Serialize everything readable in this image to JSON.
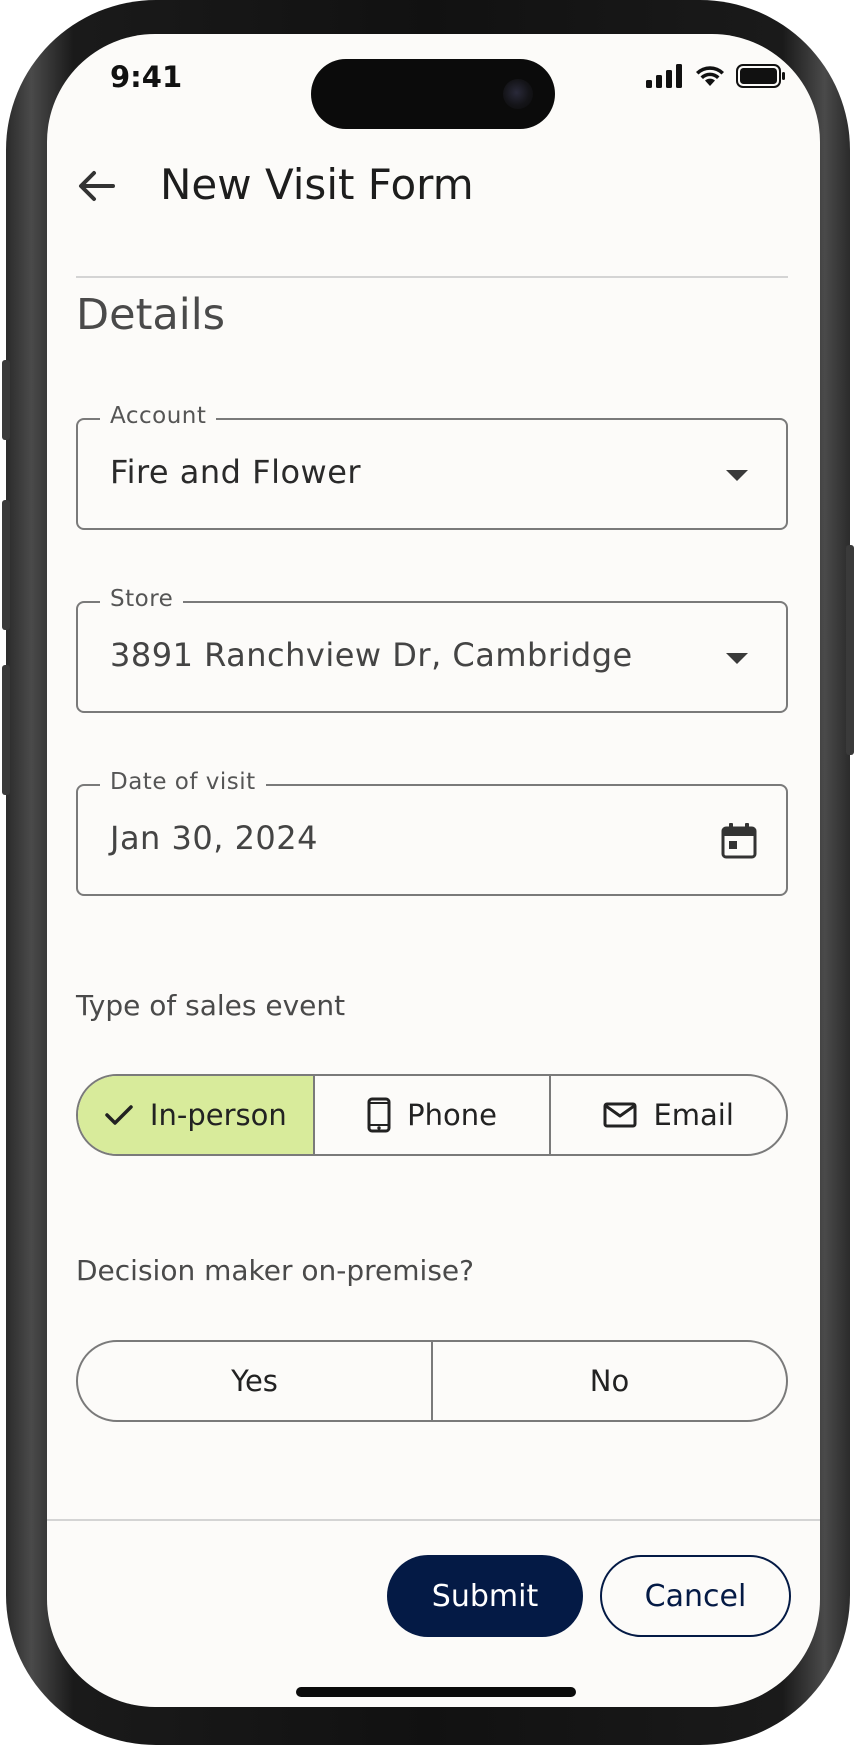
{
  "status_bar": {
    "time": "9:41"
  },
  "header": {
    "title": "New Visit Form"
  },
  "section": {
    "title": "Details"
  },
  "fields": {
    "account": {
      "label": "Account",
      "value": "Fire and Flower"
    },
    "store": {
      "label": "Store",
      "value": "3891 Ranchview Dr, Cambridge"
    },
    "date": {
      "label": "Date of visit",
      "value": "Jan 30, 2024"
    }
  },
  "sales_event": {
    "label": "Type of sales event",
    "options": [
      {
        "label": "In-person",
        "icon": "check-icon",
        "selected": true
      },
      {
        "label": "Phone",
        "icon": "phone-icon",
        "selected": false
      },
      {
        "label": "Email",
        "icon": "mail-icon",
        "selected": false
      }
    ]
  },
  "decision_maker": {
    "label": "Decision maker on-premise?",
    "options": [
      {
        "label": "Yes"
      },
      {
        "label": "No"
      }
    ]
  },
  "actions": {
    "submit_label": "Submit",
    "cancel_label": "Cancel"
  },
  "colors": {
    "accent": "#041a45",
    "selected_segment": "#d8eb9b",
    "background": "#fcfbf9"
  }
}
